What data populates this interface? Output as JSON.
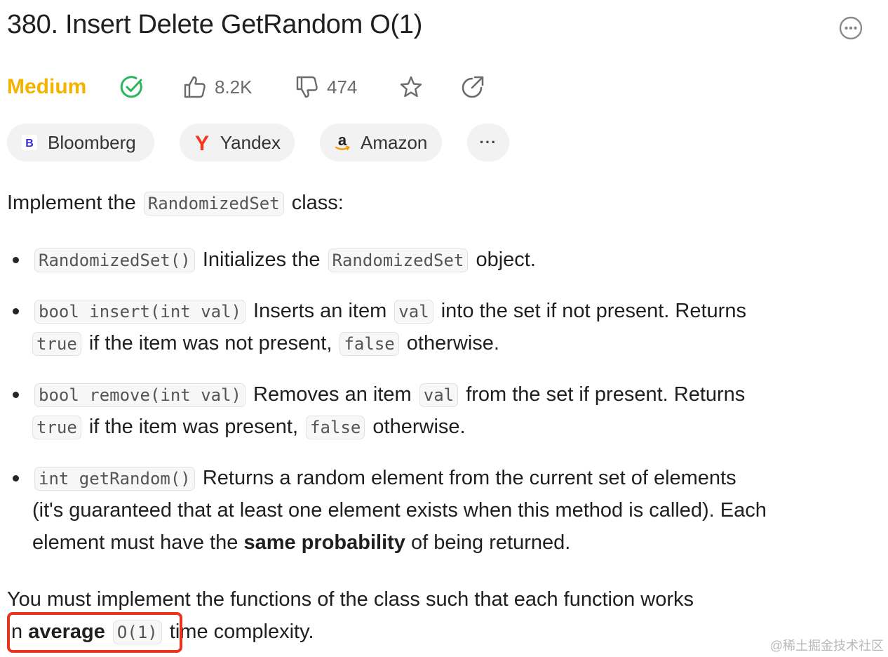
{
  "problem": {
    "title": "380. Insert Delete GetRandom O(1)",
    "difficulty": "Medium",
    "likes": "8.2K",
    "dislikes": "474"
  },
  "icons": {
    "more": "more-horizontal-circle-icon",
    "solved": "check-circle-icon",
    "like": "thumbs-up-icon",
    "dislike": "thumbs-down-icon",
    "favorite": "star-icon",
    "share": "share-arrow-icon"
  },
  "colors": {
    "medium": "#f5b300",
    "solved": "#2db55d",
    "highlight": "#e8341d"
  },
  "companies": [
    {
      "name": "Bloomberg",
      "logo_letter": "B"
    },
    {
      "name": "Yandex",
      "logo_letter": "Y"
    },
    {
      "name": "Amazon",
      "logo_letter": "a"
    }
  ],
  "more_tags_label": "···",
  "description": {
    "intro_pre": "Implement the",
    "intro_code": "RandomizedSet",
    "intro_post": "class:",
    "b1": {
      "code1": "RandomizedSet()",
      "text1": "Initializes the",
      "code2": "RandomizedSet",
      "text2": "object."
    },
    "b2": {
      "code1": "bool insert(int val)",
      "text1": "Inserts an item",
      "code2": "val",
      "text2": "into the set if not present. Returns",
      "code3": "true",
      "text3": "if the item was not present,",
      "code4": "false",
      "text4": "otherwise."
    },
    "b3": {
      "code1": "bool remove(int val)",
      "text1": "Removes an item",
      "code2": "val",
      "text2": "from the set if present. Returns",
      "code3": "true",
      "text3": "if the item was present,",
      "code4": "false",
      "text4": "otherwise."
    },
    "b4": {
      "code1": "int getRandom()",
      "text1": "Returns a random element from the current set of elements",
      "line2": "(it's guaranteed that at least one element exists when this method is called). Each",
      "line3_pre": "element must have the",
      "line3_bold": "same probability",
      "line3_post": "of being returned."
    },
    "closing_line1": "You must implement the functions of the class such that each function works",
    "closing_pre": "n",
    "closing_bold": "average",
    "closing_code": "O(1)",
    "closing_post": "time complexity."
  },
  "watermark": "@稀土掘金技术社区"
}
